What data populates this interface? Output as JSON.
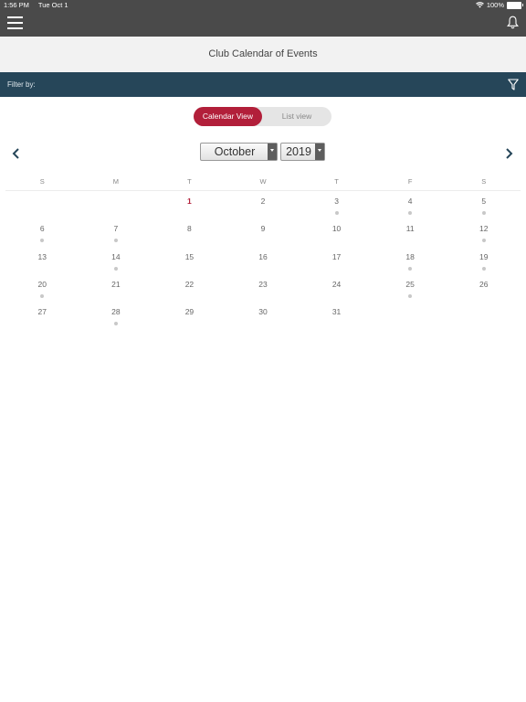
{
  "status_bar": {
    "time": "1:56 PM",
    "date": "Tue Oct 1",
    "battery": "100%"
  },
  "header": {
    "menu_icon": "hamburger-menu-icon",
    "notification_icon": "bell-icon"
  },
  "title": "Club Calendar of Events",
  "filter": {
    "label": "Filter by:",
    "icon": "filter-icon"
  },
  "view_toggle": {
    "options": [
      "Calendar View",
      "List view"
    ],
    "selected": "Calendar View"
  },
  "month_select": {
    "value": "October"
  },
  "year_select": {
    "value": "2019"
  },
  "nav": {
    "prev_icon": "chevron-left-icon",
    "next_icon": "chevron-right-icon"
  },
  "weekdays": [
    "S",
    "M",
    "T",
    "W",
    "T",
    "F",
    "S"
  ],
  "calendar": {
    "today": 1,
    "leading_blanks": 2,
    "days": [
      {
        "day": "1",
        "event": false
      },
      {
        "day": "2",
        "event": false
      },
      {
        "day": "3",
        "event": true
      },
      {
        "day": "4",
        "event": true
      },
      {
        "day": "5",
        "event": true
      },
      {
        "day": "6",
        "event": true
      },
      {
        "day": "7",
        "event": true
      },
      {
        "day": "8",
        "event": false
      },
      {
        "day": "9",
        "event": false
      },
      {
        "day": "10",
        "event": false
      },
      {
        "day": "11",
        "event": false
      },
      {
        "day": "12",
        "event": true
      },
      {
        "day": "13",
        "event": false
      },
      {
        "day": "14",
        "event": true
      },
      {
        "day": "15",
        "event": false
      },
      {
        "day": "16",
        "event": false
      },
      {
        "day": "17",
        "event": false
      },
      {
        "day": "18",
        "event": true
      },
      {
        "day": "19",
        "event": true
      },
      {
        "day": "20",
        "event": true
      },
      {
        "day": "21",
        "event": false
      },
      {
        "day": "22",
        "event": false
      },
      {
        "day": "23",
        "event": false
      },
      {
        "day": "24",
        "event": false
      },
      {
        "day": "25",
        "event": true
      },
      {
        "day": "26",
        "event": false
      },
      {
        "day": "27",
        "event": false
      },
      {
        "day": "28",
        "event": true
      },
      {
        "day": "29",
        "event": false
      },
      {
        "day": "30",
        "event": false
      },
      {
        "day": "31",
        "event": false
      }
    ]
  },
  "colors": {
    "accent": "#b21f3a",
    "filter_bar": "#264659",
    "top_bar": "#4a4a4a",
    "event_dot": "#c8c8c8"
  }
}
